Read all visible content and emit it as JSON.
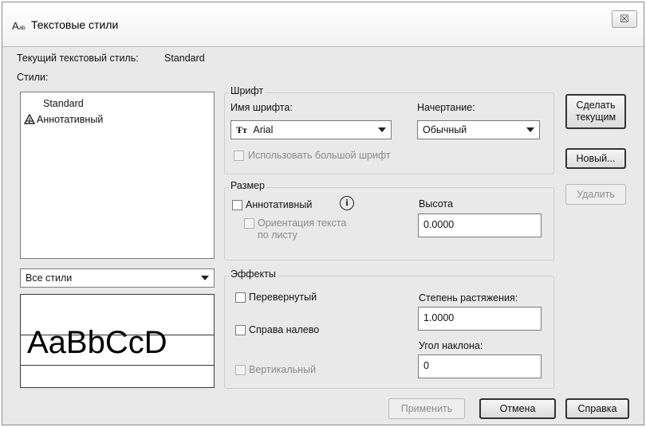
{
  "window": {
    "title": "Текстовые стили",
    "icon": "text-style-app-icon",
    "close_glyph": "☒"
  },
  "current_style": {
    "label": "Текущий текстовый стиль:",
    "value": "Standard"
  },
  "styles": {
    "label": "Стили:",
    "items": [
      {
        "name": "Standard",
        "annotative": false,
        "selected": true
      },
      {
        "name": "Аннотативный",
        "annotative": true,
        "selected": false
      }
    ],
    "annotative_icon": "annotative-scale-icon",
    "filter_selected": "Все стили"
  },
  "preview": {
    "sample_text": "AaBbCcD"
  },
  "font": {
    "group_title": "Шрифт",
    "name_label": "Имя шрифта:",
    "name_value": "Arial",
    "name_icon": "truetype-font-icon",
    "style_label": "Начертание:",
    "style_value": "Обычный",
    "bigfont_label": "Использовать большой шрифт",
    "bigfont_checked": false,
    "bigfont_enabled": false
  },
  "size": {
    "group_title": "Размер",
    "annotative_label": "Аннотативный",
    "annotative_checked": false,
    "info_icon": "info-icon",
    "orientation_label_line1": "Ориентация текста",
    "orientation_label_line2": "по листу",
    "orientation_enabled": false,
    "height_label": "Высота",
    "height_value": "0.0000"
  },
  "effects": {
    "group_title": "Эффекты",
    "upside_down_label": "Перевернутый",
    "upside_down_checked": false,
    "backwards_label": "Справа налево",
    "backwards_checked": false,
    "vertical_label": "Вертикальный",
    "vertical_enabled": false,
    "width_factor_label": "Степень растяжения:",
    "width_factor_value": "1.0000",
    "oblique_label": "Угол наклона:",
    "oblique_value": "0"
  },
  "buttons": {
    "set_current_line1": "Сделать",
    "set_current_line2": "текущим",
    "new": "Новый...",
    "delete": "Удалить",
    "apply": "Применить",
    "cancel": "Отмена",
    "help": "Справка"
  }
}
